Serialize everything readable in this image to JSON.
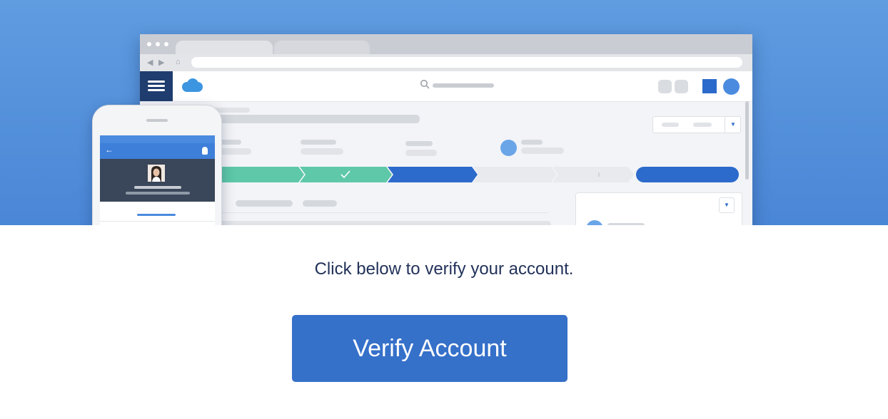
{
  "hero": {
    "illustration": "salesforce-desktop-and-mobile-mockup",
    "background_color": "#5a98dd",
    "browser": {
      "logo": "salesforce-cloud-icon",
      "icons": [
        "back-arrow-icon",
        "forward-arrow-icon",
        "home-icon",
        "menu-icon",
        "search-icon",
        "user-avatar-icon"
      ],
      "path_colors": {
        "completed": "#5ec8a8",
        "current": "#2c6bcc",
        "upcoming": "#e8eaee"
      }
    },
    "phone": {
      "icons": [
        "back-arrow-icon",
        "user-icon",
        "profile-photo"
      ]
    }
  },
  "body": {
    "message": "Click below to verify your account.",
    "text_color": "#22325a"
  },
  "cta": {
    "label": "Verify Account",
    "color": "#3570c9"
  }
}
